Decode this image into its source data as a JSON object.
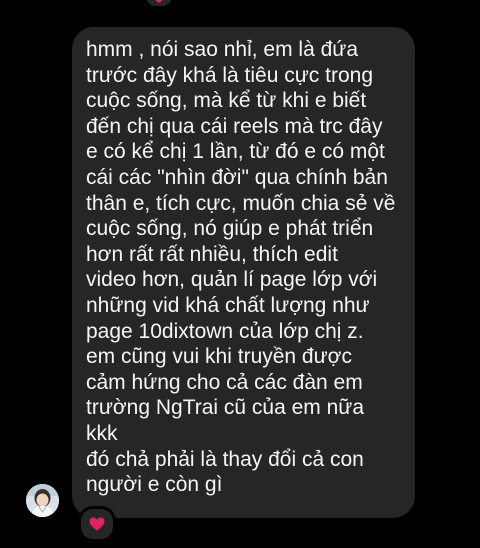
{
  "message": {
    "lines": [
      "hmm , nói sao nhỉ, em là đứa",
      "trước đây khá là tiêu cực trong",
      "cuộc sống, mà kể từ khi e biết",
      "đến chị qua cái reels mà trc đây",
      "e có kể chị 1 lần, từ đó e có một",
      "cái các \"nhìn đời\" qua chính bản",
      "thân e, tích cực, muốn chia sẻ về",
      "cuộc sống, nó giúp e phát triển",
      "hơn rất rất nhiều, thích edit",
      "video hơn, quản lí page lớp với",
      "những vid khá chất lượng như",
      "page 10dixtown của lớp chị z.",
      "em cũng vui khi truyền được",
      "cảm hứng cho cả các đàn em",
      "trường NgTrai cũ của em nữa",
      "kkk",
      "đó chả phải là thay đổi cả con",
      "người e còn gì"
    ],
    "reaction_icon": "heart-icon",
    "reaction_color": "#e0245e"
  },
  "colors": {
    "background": "#000000",
    "bubble": "#262626",
    "text": "#f5f5f5"
  }
}
